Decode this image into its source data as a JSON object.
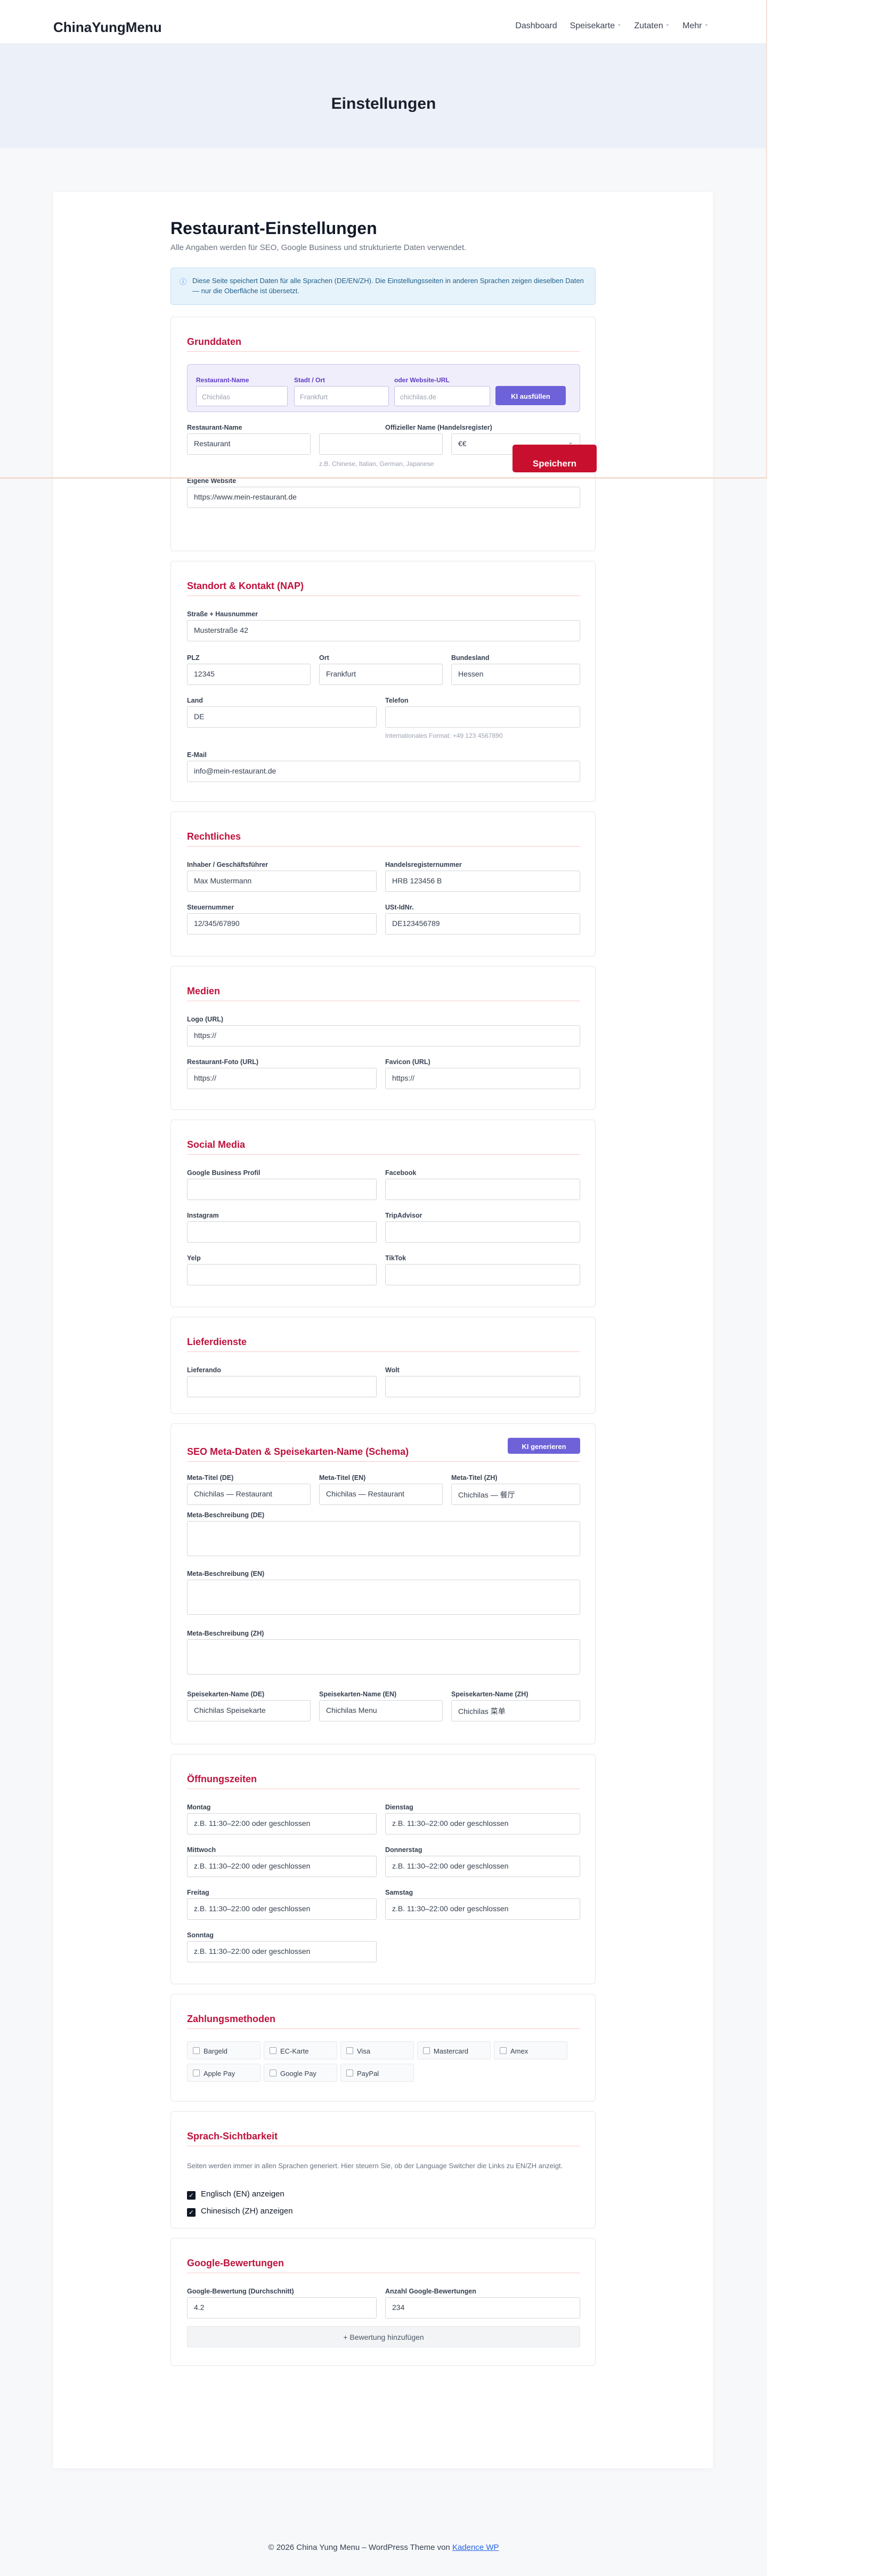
{
  "site": {
    "brand": "ChinaYungMenu",
    "nav": [
      "Dashboard",
      "Speisekarte",
      "Zutaten",
      "Mehr"
    ]
  },
  "hero": {
    "title": "Einstellungen"
  },
  "page": {
    "title": "Restaurant-Einstellungen",
    "subtitle": "Alle Angaben werden für SEO, Google Business und strukturierte Daten verwendet.",
    "info": "Diese Seite speichert Daten für alle Sprachen (DE/EN/ZH). Die Einstellungsseiten in anderen Sprachen zeigen dieselben Daten — nur die Oberfläche ist übersetzt.",
    "info_icon": "ⓘ"
  },
  "grunddaten": {
    "title": "Grunddaten",
    "autofill": {
      "name_label": "Restaurant-Name",
      "name_placeholder": "Chichilas",
      "city_label": "Stadt / Ort",
      "city_placeholder": "Frankfurt",
      "url_label": "oder Website-URL",
      "url_placeholder": "chichilas.de",
      "button": "KI ausfüllen"
    },
    "name_label": "Restaurant-Name",
    "official_label": "Offizieller Name (Handelsregister)",
    "type_value": "Restaurant",
    "price_value": "€€",
    "cuisine_hint": "z.B. Chinese, Italian, German, Japanese",
    "website_label": "Eigene Website",
    "website_value": "https://www.mein-restaurant.de"
  },
  "nap": {
    "title": "Standort & Kontakt (NAP)",
    "street_label": "Straße + Hausnummer",
    "street_value": "Musterstraße 42",
    "plz_label": "PLZ",
    "plz_value": "12345",
    "city_label": "Ort",
    "city_value": "Frankfurt",
    "state_label": "Bundesland",
    "state_value": "Hessen",
    "country_label": "Land",
    "country_value": "DE",
    "phone_label": "Telefon",
    "phone_hint": "Internationales Format: +49 123 4567890",
    "email_label": "E-Mail",
    "email_value": "info@mein-restaurant.de"
  },
  "legal": {
    "title": "Rechtliches",
    "owner_label": "Inhaber / Geschäftsführer",
    "owner_value": "Max Mustermann",
    "hr_label": "Handelsregisternummer",
    "hr_value": "HRB 123456 B",
    "tax_label": "Steuernummer",
    "tax_value": "12/345/67890",
    "vat_label": "USt-IdNr.",
    "vat_value": "DE123456789"
  },
  "media": {
    "title": "Medien",
    "logo_label": "Logo (URL)",
    "logo_value": "https://",
    "photo_label": "Restaurant-Foto (URL)",
    "photo_value": "https://",
    "favicon_label": "Favicon (URL)",
    "favicon_value": "https://"
  },
  "social": {
    "title": "Social Media",
    "labels": [
      "Google Business Profil",
      "Facebook",
      "Instagram",
      "TripAdvisor",
      "Yelp",
      "TikTok"
    ]
  },
  "delivery": {
    "title": "Lieferdienste",
    "labels": [
      "Lieferando",
      "Wolt"
    ]
  },
  "seo": {
    "title": "SEO Meta-Daten & Speisekarten-Name (Schema)",
    "button": "KI generieren",
    "meta_de_label": "Meta-Titel (DE)",
    "meta_de_value": "Chichilas — Restaurant",
    "meta_en_label": "Meta-Titel (EN)",
    "meta_en_value": "Chichilas — Restaurant",
    "meta_zh_label": "Meta-Titel (ZH)",
    "meta_zh_value": "Chichilas — 餐厅",
    "desc_de_label": "Meta-Beschreibung (DE)",
    "desc_en_label": "Meta-Beschreibung (EN)",
    "desc_zh_label": "Meta-Beschreibung (ZH)",
    "menu_de_label": "Speisekarten-Name (DE)",
    "menu_de_value": "Chichilas Speisekarte",
    "menu_en_label": "Speisekarten-Name (EN)",
    "menu_en_value": "Chichilas Menu",
    "menu_zh_label": "Speisekarten-Name (ZH)",
    "menu_zh_value": "Chichilas 菜单"
  },
  "hours": {
    "title": "Öffnungszeiten",
    "placeholder": "z.B. 11:30–22:00 oder geschlossen",
    "days": [
      "Montag",
      "Dienstag",
      "Mittwoch",
      "Donnerstag",
      "Freitag",
      "Samstag",
      "Sonntag"
    ]
  },
  "payment": {
    "title": "Zahlungsmethoden",
    "methods": [
      "Bargeld",
      "EC-Karte",
      "Visa",
      "Mastercard",
      "Amex",
      "Apple Pay",
      "Google Pay",
      "PayPal"
    ]
  },
  "language": {
    "title": "Sprach-Sichtbarkeit",
    "note": "Seiten werden immer in allen Sprachen generiert. Hier steuern Sie, ob der Language Switcher die Links zu EN/ZH anzeigt.",
    "en": "Englisch (EN) anzeigen",
    "zh": "Chinesisch (ZH) anzeigen"
  },
  "reviews": {
    "title": "Google-Bewertungen",
    "rating_label": "Google-Bewertung (Durchschnitt)",
    "rating_value": "4.2",
    "count_label": "Anzahl Google-Bewertungen",
    "count_value": "234",
    "add": "+ Bewertung hinzufügen"
  },
  "actions": {
    "save": "Speichern"
  },
  "footer": {
    "text": "© 2026 China Yung Menu – WordPress Theme von",
    "link": "Kadence WP"
  }
}
